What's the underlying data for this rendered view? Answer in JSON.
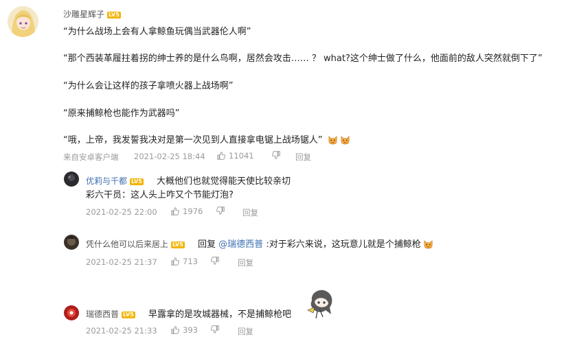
{
  "main_comment": {
    "author": "沙雕星辉子",
    "level_badge": "LV5",
    "lines": [
      "“为什么战场上会有人拿鲸鱼玩偶当武器伦人啊”",
      "“那个西装革履拄着拐的绅士养的是什么鸟啊，居然会攻击…… ？ what?这个绅士做了什么，他面前的敌人突然就倒下了”",
      "“为什么会让这样的孩子拿喷火器上战场啊”",
      "“原来捕鲸枪也能作为武器吗”",
      "“哦，上帝，我发誓我决对是第一次见到人直接拿电锯上战场锯人”"
    ],
    "source": "来自安卓客户端",
    "time": "2021-02-25 18:44",
    "likes": "11041",
    "reply_label": "回复"
  },
  "replies": [
    {
      "author": "优莉与千都",
      "level_badge": "LV5",
      "text_line1": "大概他们也就觉得能天使比较亲切",
      "text_line2": "彩六干员：这人头上咋又个节能灯泡?",
      "time": "2021-02-25 22:00",
      "likes": "1976",
      "reply_label": "回复"
    },
    {
      "author": "凭什么他可以后来居上",
      "level_badge": "LV5",
      "reply_prefix": "回复",
      "mention": "@瑞德西普",
      "text": ":对于彩六来说，这玩意儿就是个捕鲸枪",
      "time": "2021-02-25 21:37",
      "likes": "713",
      "reply_label": "回复"
    },
    {
      "author": "瑞德西普",
      "level_badge": "LV5",
      "text": "早露拿的是攻城器械，不是捕鲸枪吧",
      "time": "2021-02-25 21:33",
      "likes": "393",
      "reply_label": "回复"
    }
  ],
  "icons": {
    "comment": "comment-icon",
    "like": "thumbs-up-icon",
    "dislike": "thumbs-down-icon",
    "emoji": "cat-face-emoji-icon"
  },
  "colors": {
    "name_blue": "#3e6fb0",
    "meta_gray": "#9a9a9a",
    "badge": "#f2b400"
  }
}
